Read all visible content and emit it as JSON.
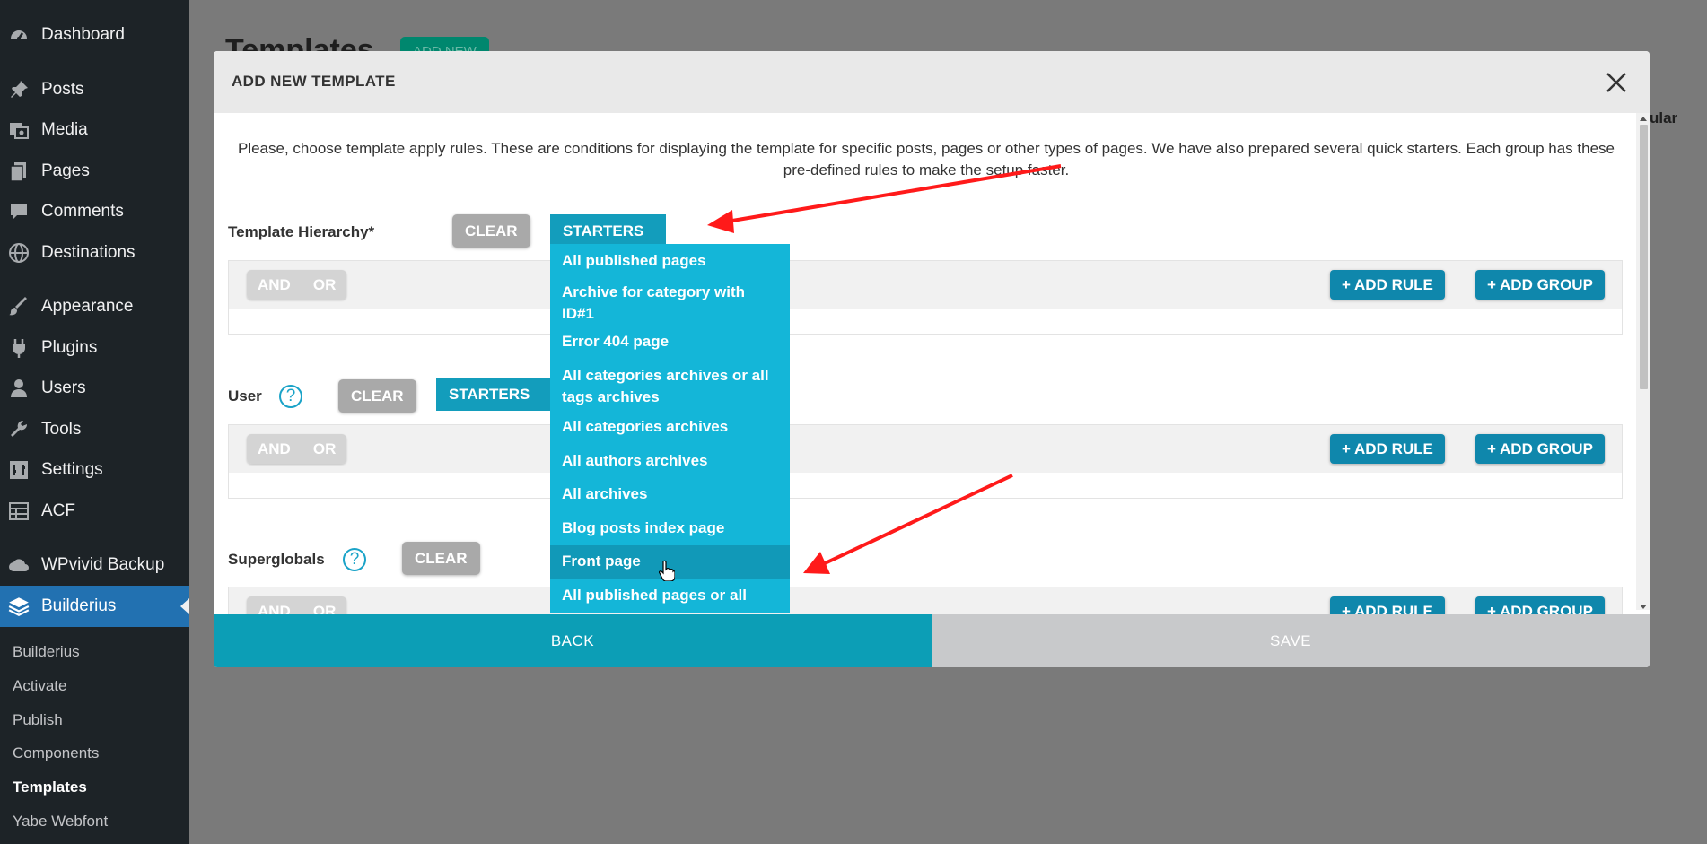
{
  "sidebar": {
    "items": [
      {
        "label": "Dashboard",
        "icon": "dashboard-icon"
      },
      {
        "label": "Posts",
        "icon": "pin-icon"
      },
      {
        "label": "Media",
        "icon": "media-icon"
      },
      {
        "label": "Pages",
        "icon": "pages-icon"
      },
      {
        "label": "Comments",
        "icon": "comment-icon"
      },
      {
        "label": "Destinations",
        "icon": "globe-icon"
      },
      {
        "label": "Appearance",
        "icon": "brush-icon"
      },
      {
        "label": "Plugins",
        "icon": "plug-icon"
      },
      {
        "label": "Users",
        "icon": "user-icon"
      },
      {
        "label": "Tools",
        "icon": "wrench-icon"
      },
      {
        "label": "Settings",
        "icon": "settings-icon"
      },
      {
        "label": "ACF",
        "icon": "table-icon"
      },
      {
        "label": "WPvivid Backup",
        "icon": "cloud-icon"
      },
      {
        "label": "Builderius",
        "icon": "layers-icon"
      }
    ],
    "submenu": [
      "Builderius",
      "Activate",
      "Publish",
      "Components",
      "Templates",
      "Yabe Webfont"
    ],
    "current_submenu": "Templates"
  },
  "background_page": {
    "title": "Templates",
    "add_new": "ADD NEW",
    "edge_text": "ular"
  },
  "modal": {
    "title": "ADD NEW TEMPLATE",
    "intro": "Please, choose template apply rules. These are conditions for displaying the template for specific posts, pages or other types of pages. We have also prepared several quick starters. Each group has these pre-defined rules to make the setup faster.",
    "sections": [
      {
        "label": "Template Hierarchy*",
        "help": "?",
        "clear": "CLEAR",
        "starters": "STARTERS",
        "and": "AND",
        "or": "OR",
        "add_rule": "+ ADD RULE",
        "add_group": "+ ADD GROUP"
      },
      {
        "label": "User",
        "help": "?",
        "clear": "CLEAR",
        "starters": "STARTERS",
        "and": "AND",
        "or": "OR",
        "add_rule": "+ ADD RULE",
        "add_group": "+ ADD GROUP"
      },
      {
        "label": "Superglobals",
        "help": "?",
        "clear": "CLEAR",
        "and": "AND",
        "or": "OR",
        "add_rule": "+ ADD RULE",
        "add_group": "+ ADD GROUP"
      }
    ],
    "dropdown_items": [
      "All published pages",
      "Archive for category with ID#1",
      "Error 404 page",
      "All categories archives or all tags archives",
      "All categories archives",
      "All authors archives",
      "All archives",
      "Blog posts index page",
      "Front page",
      "All published pages or all"
    ],
    "highlighted_item": "Front page",
    "back": "BACK",
    "save": "SAVE"
  },
  "colors": {
    "sidebar_bg": "#1d2327",
    "active_menu": "#2271b1",
    "teal": "#0c9eb6",
    "dropdown": "#14b6d8",
    "arrow": "#ff0000"
  }
}
